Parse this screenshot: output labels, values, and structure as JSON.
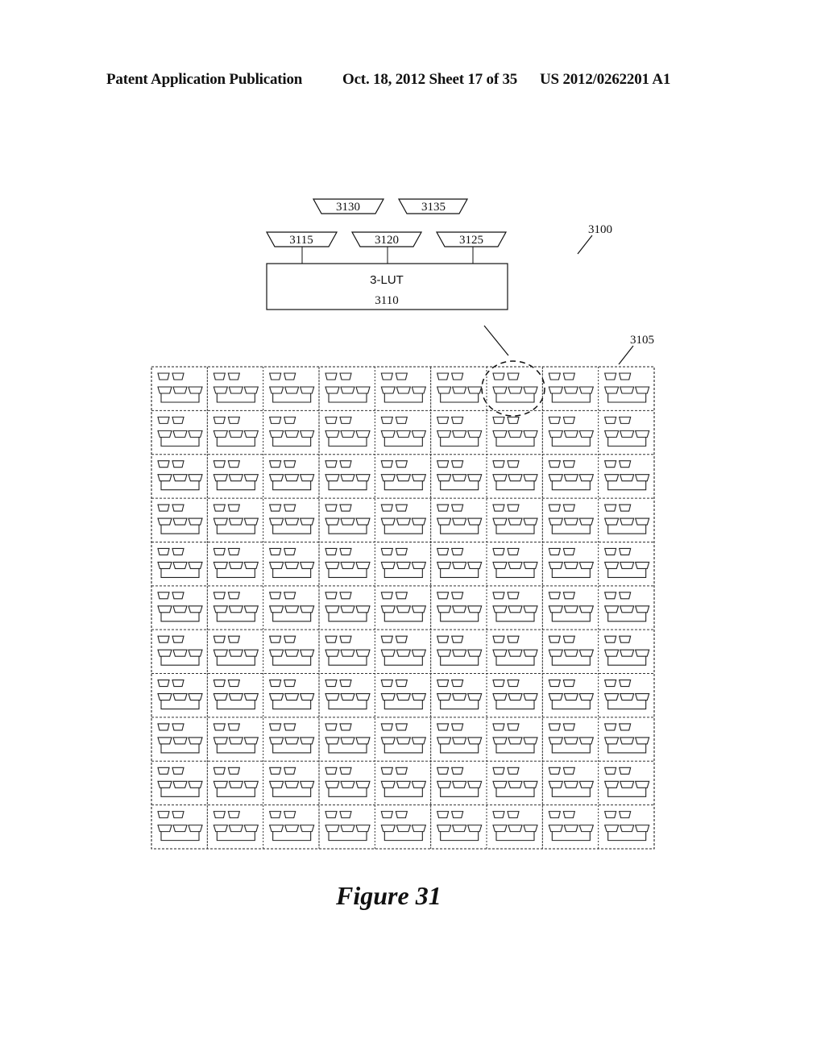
{
  "header": {
    "publication": "Patent Application Publication",
    "date_sheet": "Oct. 18, 2012   Sheet 17 of 35",
    "patent_number": "US 2012/0262201 A1"
  },
  "figure": {
    "caption": "Figure 31",
    "reference": "3100",
    "lut_block": {
      "title": "3-LUT",
      "ref": "3110"
    },
    "input_muxes": [
      "3115",
      "3120",
      "3125"
    ],
    "extra_muxes": [
      "3130",
      "3135"
    ],
    "grid": {
      "ref": "3105",
      "rows": 11,
      "cols": 9,
      "highlighted_cell": {
        "row": 1,
        "col": 7
      }
    }
  }
}
